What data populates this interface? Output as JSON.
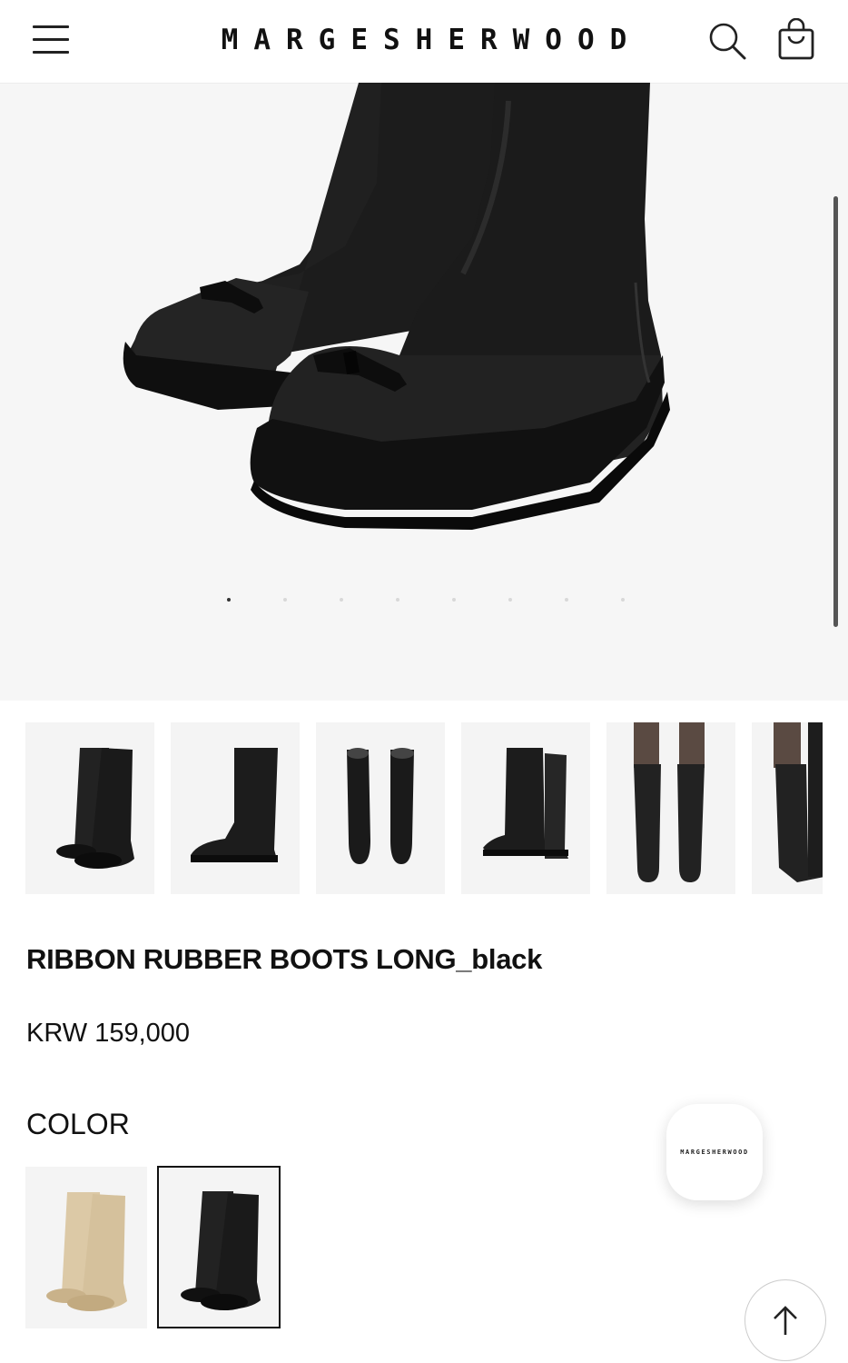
{
  "header": {
    "logo": "MARGESHERWOOD",
    "menu_icon": "hamburger-menu-icon",
    "search_icon": "search-icon",
    "cart_icon": "shopping-bag-icon"
  },
  "gallery": {
    "slide_count": 8,
    "active_slide": 1
  },
  "thumbnails": [
    {
      "name": "boots-pair-angled"
    },
    {
      "name": "boot-side"
    },
    {
      "name": "boots-top-view"
    },
    {
      "name": "boots-back-angled"
    },
    {
      "name": "model-wearing-front"
    },
    {
      "name": "model-wearing-side"
    }
  ],
  "product": {
    "title": "RIBBON RUBBER BOOTS LONG_black",
    "price": "KRW 159,000",
    "color_label": "COLOR",
    "colors": [
      {
        "name": "beige",
        "hex": "#dcc9a6",
        "selected": false
      },
      {
        "name": "black",
        "hex": "#1a1a1a",
        "selected": true
      }
    ]
  },
  "chat_button": {
    "label": "MARGESHERWOOD"
  },
  "scroll_top_icon": "arrow-up-icon"
}
